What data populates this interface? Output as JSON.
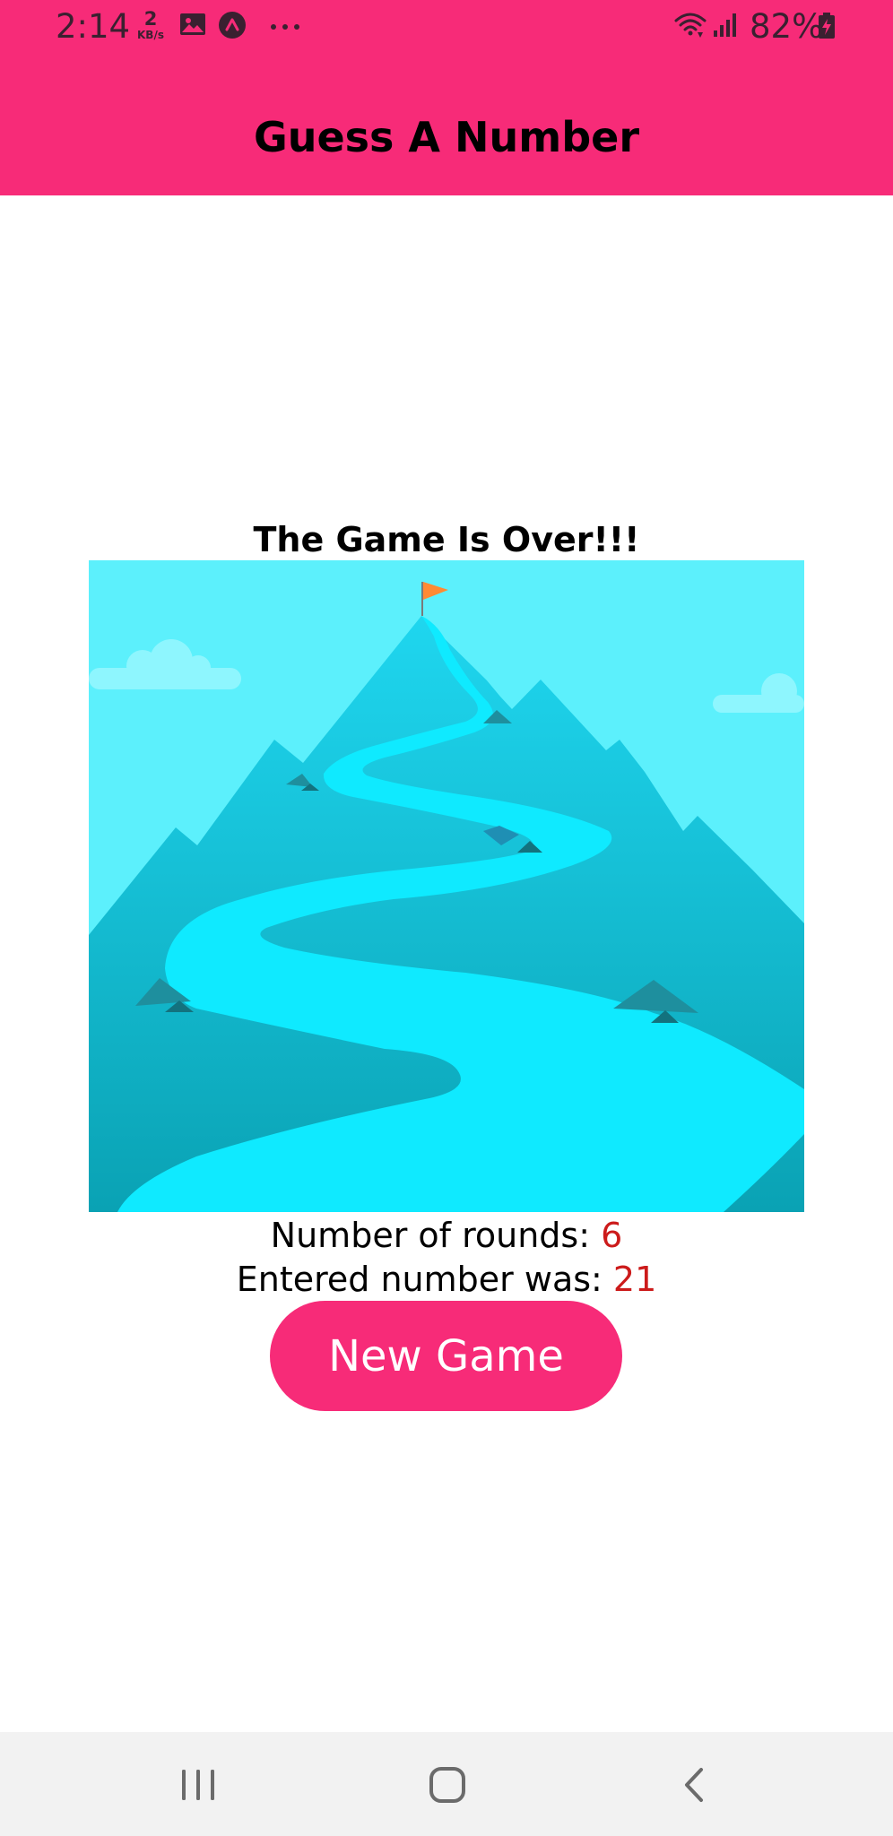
{
  "status_bar": {
    "time": "2:14",
    "net_speed_value": "2",
    "net_speed_unit": "KB/s",
    "battery_percent": "82%",
    "icons": [
      "gallery-icon",
      "app-notification-icon",
      "more-icon",
      "wifi-icon",
      "signal-icon",
      "battery-charging-icon"
    ]
  },
  "header": {
    "title": "Guess A Number",
    "background_color": "#f72b78"
  },
  "game_over": {
    "title": "The Game Is Over!!!",
    "image_description_icon": "mountain-summit-illustration",
    "rounds_label": "Number of rounds: ",
    "rounds_value": "6",
    "number_label": "Entered number was: ",
    "number_value": "21",
    "highlight_color": "#cc1b1b",
    "new_game_label": "New Game"
  },
  "nav_bar": {
    "icons": [
      "recents-icon",
      "home-icon",
      "back-icon"
    ]
  }
}
